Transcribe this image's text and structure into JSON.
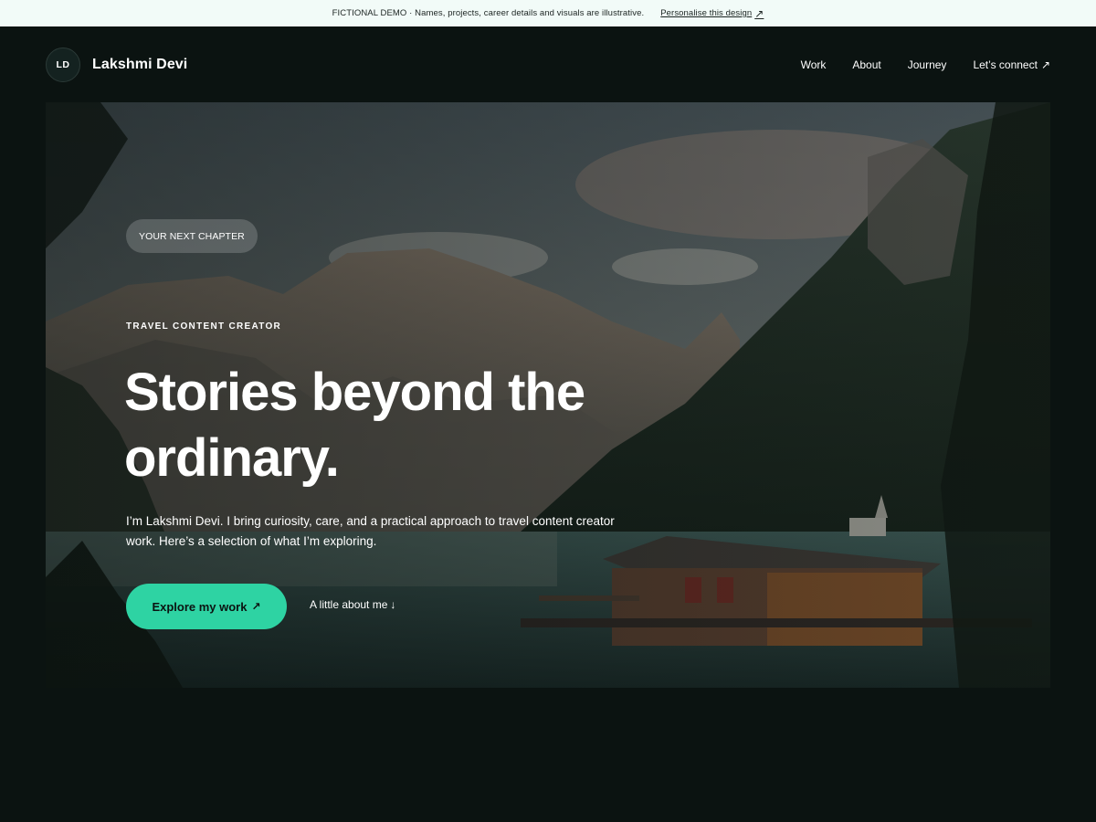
{
  "banner": {
    "notice": "FICTIONAL DEMO · Names, projects, career details and visuals are illustrative.",
    "cta_label": "Personalise this design",
    "cta_icon": "arrow-up-right-icon"
  },
  "header": {
    "avatar_initials": "LD",
    "brand_name": "Lakshmi Devi",
    "nav": [
      {
        "label": "Work"
      },
      {
        "label": "About"
      },
      {
        "label": "Journey"
      },
      {
        "label": "Let’s connect",
        "icon": "arrow-up-right-icon"
      }
    ]
  },
  "hero": {
    "chip": "YOUR NEXT CHAPTER",
    "eyebrow": "TRAVEL CONTENT CREATOR",
    "headline": "Stories beyond the ordinary.",
    "intro": "I’m Lakshmi Devi. I bring curiosity, care, and a practical approach to travel content creator work. Here’s a selection of what I’m exploring.",
    "primary_cta": "Explore my work",
    "primary_cta_icon": "arrow-up-right-icon",
    "secondary_cta": "A little about me",
    "secondary_cta_icon": "arrow-down-icon",
    "image_subject": "mountain-lake-boathouse-photo"
  },
  "colors": {
    "page_bg": "#0b1311",
    "banner_bg": "#f2fbf8",
    "accent": "#2ed3a3",
    "text": "#ffffff"
  }
}
